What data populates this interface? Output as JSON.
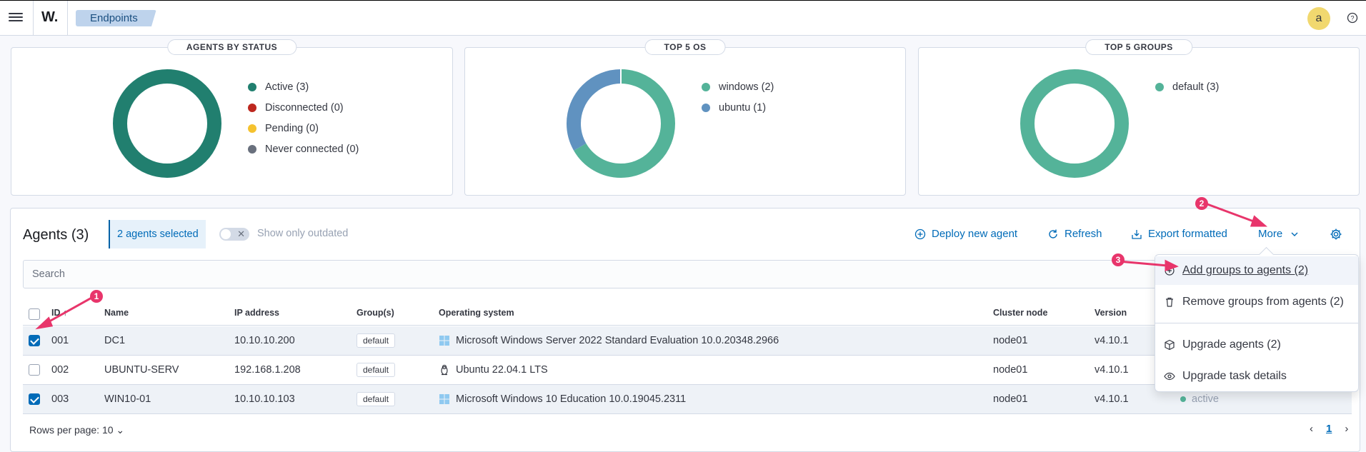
{
  "header": {
    "logo": "W.",
    "breadcrumb": "Endpoints",
    "avatar_initial": "a"
  },
  "panels": [
    {
      "title": "AGENTS BY STATUS",
      "legend": [
        {
          "label": "Active (3)",
          "color": "#217f6f"
        },
        {
          "label": "Disconnected (0)",
          "color": "#bd271e"
        },
        {
          "label": "Pending (0)",
          "color": "#f5c22f"
        },
        {
          "label": "Never connected (0)",
          "color": "#69707d"
        }
      ]
    },
    {
      "title": "TOP 5 OS",
      "legend": [
        {
          "label": "windows (2)",
          "color": "#54b399"
        },
        {
          "label": "ubuntu (1)",
          "color": "#6092c0"
        }
      ]
    },
    {
      "title": "TOP 5 GROUPS",
      "legend": [
        {
          "label": "default (3)",
          "color": "#54b399"
        }
      ]
    }
  ],
  "chart_data": [
    {
      "type": "pie",
      "categories": [
        "Active",
        "Disconnected",
        "Pending",
        "Never connected"
      ],
      "values": [
        3,
        0,
        0,
        0
      ]
    },
    {
      "type": "pie",
      "categories": [
        "windows",
        "ubuntu"
      ],
      "values": [
        2,
        1
      ]
    },
    {
      "type": "pie",
      "categories": [
        "default"
      ],
      "values": [
        3
      ]
    }
  ],
  "agents": {
    "title": "Agents (3)",
    "selected_badge": "2 agents selected",
    "toggle_label": "Show only outdated",
    "actions": {
      "deploy": "Deploy new agent",
      "refresh": "Refresh",
      "export": "Export formatted",
      "more": "More"
    },
    "search_placeholder": "Search",
    "columns": [
      "ID",
      "Name",
      "IP address",
      "Group(s)",
      "Operating system",
      "Cluster node",
      "Version"
    ],
    "rows": [
      {
        "id": "001",
        "name": "DC1",
        "ip": "10.10.10.200",
        "group": "default",
        "os": "Microsoft Windows Server 2022 Standard Evaluation 10.0.20348.2966",
        "os_icon": "windows-icon",
        "node": "node01",
        "version": "v4.10.1",
        "selected": true
      },
      {
        "id": "002",
        "name": "UBUNTU-SERV",
        "ip": "192.168.1.208",
        "group": "default",
        "os": "Ubuntu 22.04.1 LTS",
        "os_icon": "linux-icon",
        "node": "node01",
        "version": "v4.10.1",
        "selected": false
      },
      {
        "id": "003",
        "name": "WIN10-01",
        "ip": "10.10.10.103",
        "group": "default",
        "os": "Microsoft Windows 10 Education 10.0.19045.2311",
        "os_icon": "windows-icon",
        "node": "node01",
        "version": "v4.10.1",
        "selected": true,
        "status": "active"
      }
    ],
    "rows_per_page": "Rows per page: 10",
    "current_page": "1"
  },
  "more_menu": {
    "items": [
      {
        "label": "Add groups to agents (2)",
        "icon": "add-group-icon"
      },
      {
        "label": "Remove groups from agents (2)",
        "icon": "trash-icon"
      },
      {
        "label": "Upgrade agents (2)",
        "icon": "package-icon"
      },
      {
        "label": "Upgrade task details",
        "icon": "eye-icon"
      }
    ]
  },
  "annotations": {
    "steps": [
      "1",
      "2",
      "3"
    ],
    "arrow_color": "#e8356b"
  }
}
